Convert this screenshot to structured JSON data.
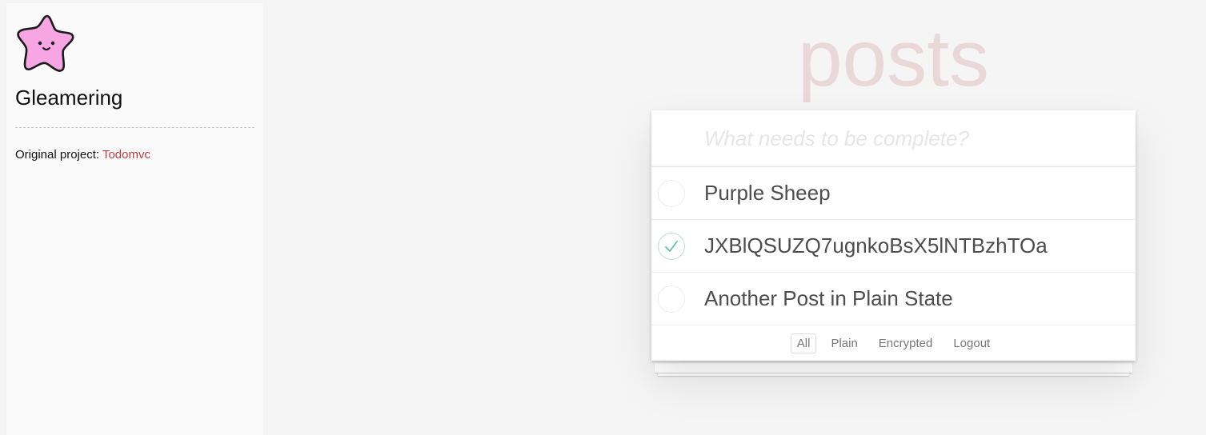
{
  "sidebar": {
    "logo_icon": "star-face-logo",
    "app_name": "Gleamering",
    "original_project_label": "Original project:",
    "original_project_link": "Todomvc"
  },
  "main": {
    "heading": "posts",
    "new_todo_placeholder": "What needs to be complete?",
    "items": [
      {
        "label": "Purple Sheep",
        "completed": false
      },
      {
        "label": "JXBlQSUZQ7ugnkoBsX5lNTBzhTOa",
        "completed": true
      },
      {
        "label": "Another Post in Plain State",
        "completed": false
      }
    ],
    "filters": [
      {
        "label": "All",
        "selected": true
      },
      {
        "label": "Plain",
        "selected": false
      },
      {
        "label": "Encrypted",
        "selected": false
      },
      {
        "label": "Logout",
        "selected": false
      }
    ]
  },
  "colors": {
    "accent": "#b83f45",
    "heading": "#e9d4d4",
    "check": "#5dc2af",
    "logo_fill": "#f7a6e3"
  }
}
